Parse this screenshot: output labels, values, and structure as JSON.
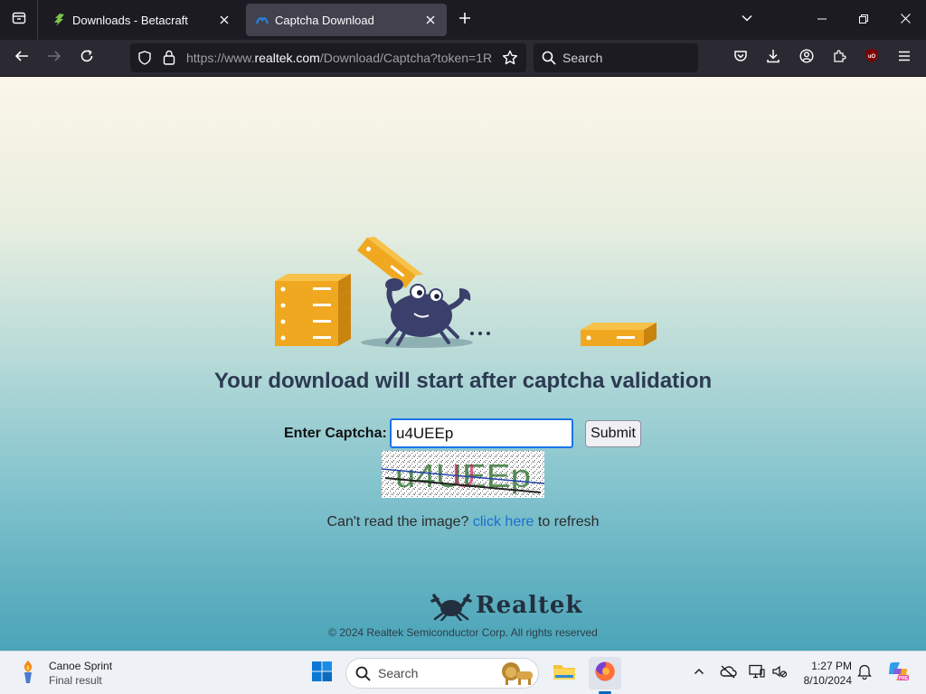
{
  "browser": {
    "tabs": [
      {
        "title": "Downloads - Betacraft",
        "active": false
      },
      {
        "title": "Captcha Download",
        "active": true
      }
    ],
    "url": {
      "scheme": "https://www.",
      "host": "realtek.com",
      "path": "/Download/Captcha?token=1R"
    },
    "search_placeholder": "Search"
  },
  "page": {
    "headline": "Your download will start after captcha validation",
    "captcha_label": "Enter Captcha:",
    "captcha_value": "u4UEEp",
    "submit_label": "Submit",
    "captcha_image_text": "u4UEEp",
    "refresh_prefix": "Can't read the image?",
    "refresh_link": "click here",
    "refresh_suffix": "to refresh",
    "brand": "Realtek",
    "copyright": "© 2024 Realtek Semiconductor Corp. All rights reserved"
  },
  "taskbar": {
    "widget_title": "Canoe Sprint",
    "widget_subtitle": "Final result",
    "search_placeholder": "Search",
    "time": "1:27 PM",
    "date": "8/10/2024"
  },
  "colors": {
    "accent_blue": "#1a73e8",
    "link": "#1a6fd0",
    "server_orange": "#f0a820",
    "crab": "#3b3f6b",
    "headline": "#2c3a52"
  }
}
